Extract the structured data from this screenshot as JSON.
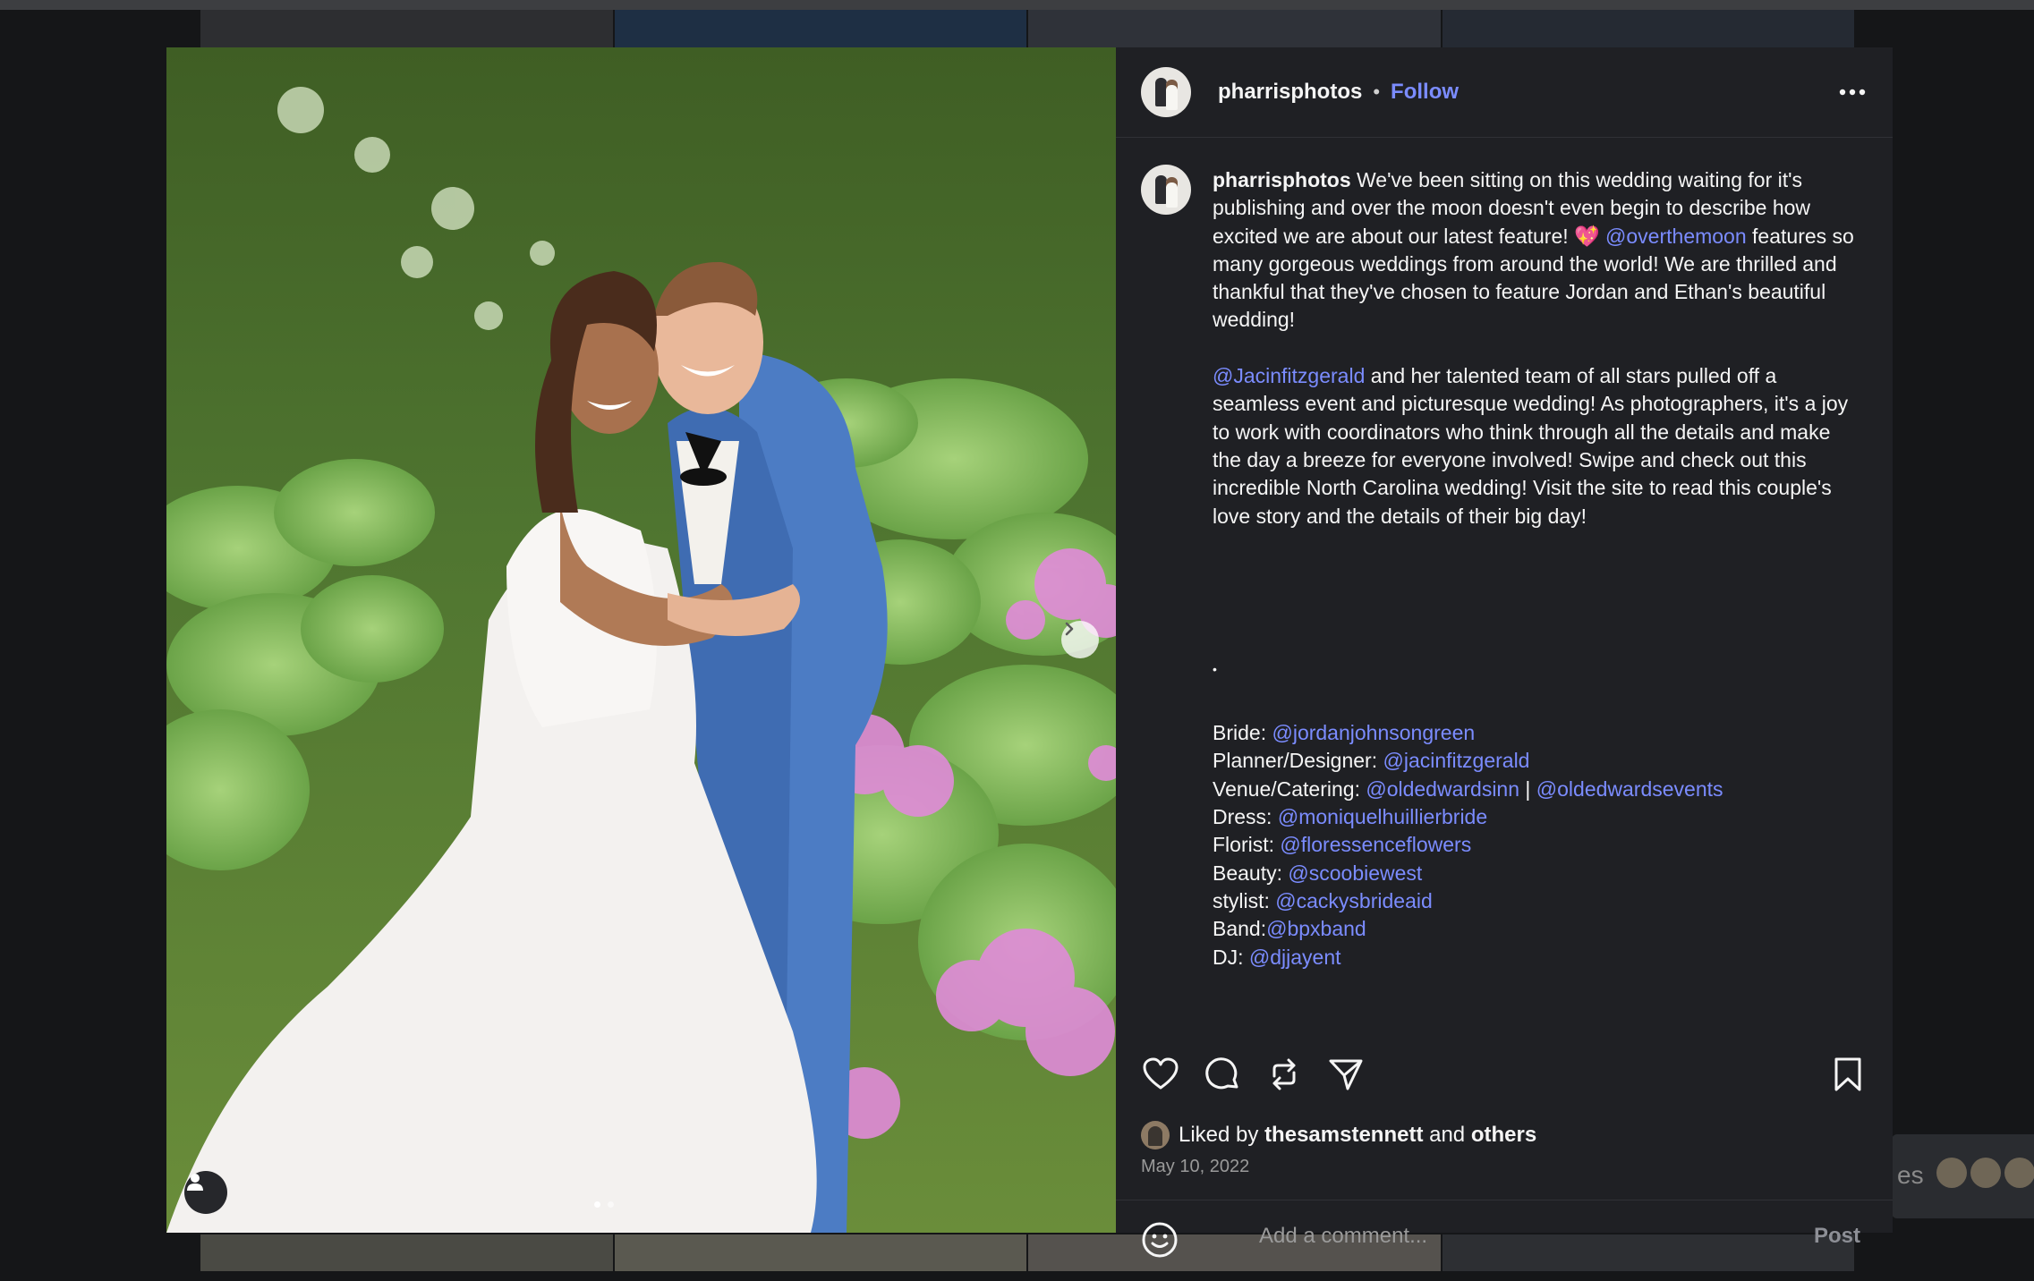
{
  "post": {
    "username": "pharrisphotos",
    "separator": "•",
    "follow_label": "Follow",
    "more_icon": "more-horizontal-icon"
  },
  "caption": {
    "username": "pharrisphotos",
    "para1_text": " We've been sitting on this wedding waiting for it's publishing and over the moon doesn't even begin to describe how excited we are about our latest feature! 💖 ",
    "para1_mention": "@overthemoon",
    "para1_rest": " features so many gorgeous weddings from around the world! We are thrilled and thankful that they've chosen to feature Jordan and Ethan's beautiful wedding!",
    "para2_mention": "@Jacinfitzgerald",
    "para2_rest": " and her talented team of all stars pulled off a seamless event and picturesque wedding! As photographers, it's a joy to work with coordinators who think through all the details and make the day a breeze for everyone involved! Swipe and check out this incredible North Carolina wedding! Visit the site to read this couple's love story and the details of their big day!",
    "dot": "•",
    "credits": [
      {
        "label": "Bride: ",
        "handle": "@jordanjohnsongreen"
      },
      {
        "label": "Planner/Designer: ",
        "handle": "@jacinfitzgerald"
      },
      {
        "label": "Venue/Catering: ",
        "handle": "@oldedwardsinn",
        "sep": " | ",
        "handle2": "@oldedwardsevents"
      },
      {
        "label": "Dress: ",
        "handle": "@moniquelhuillierbride"
      },
      {
        "label": "Florist: ",
        "handle": "@floressenceflowers"
      },
      {
        "label": "Beauty: ",
        "handle": "@scoobiewest"
      },
      {
        "label": "stylist: ",
        "handle": "@cackysbrideaid"
      },
      {
        "label": "Band:",
        "handle": "@bpxband"
      },
      {
        "label": "DJ: ",
        "handle": "@djjayent"
      }
    ]
  },
  "engagement": {
    "liked_by_prefix": "Liked by ",
    "liked_by_user": "thesamstennett",
    "liked_and": " and ",
    "liked_others": "others",
    "date": "May 10, 2022"
  },
  "comment": {
    "placeholder": "Add a comment...",
    "post_label": "Post"
  },
  "background": {
    "partial_text": "es"
  },
  "colors": {
    "panel_bg": "#1f2024",
    "link": "#7b8cff",
    "page_bg": "#151618"
  }
}
